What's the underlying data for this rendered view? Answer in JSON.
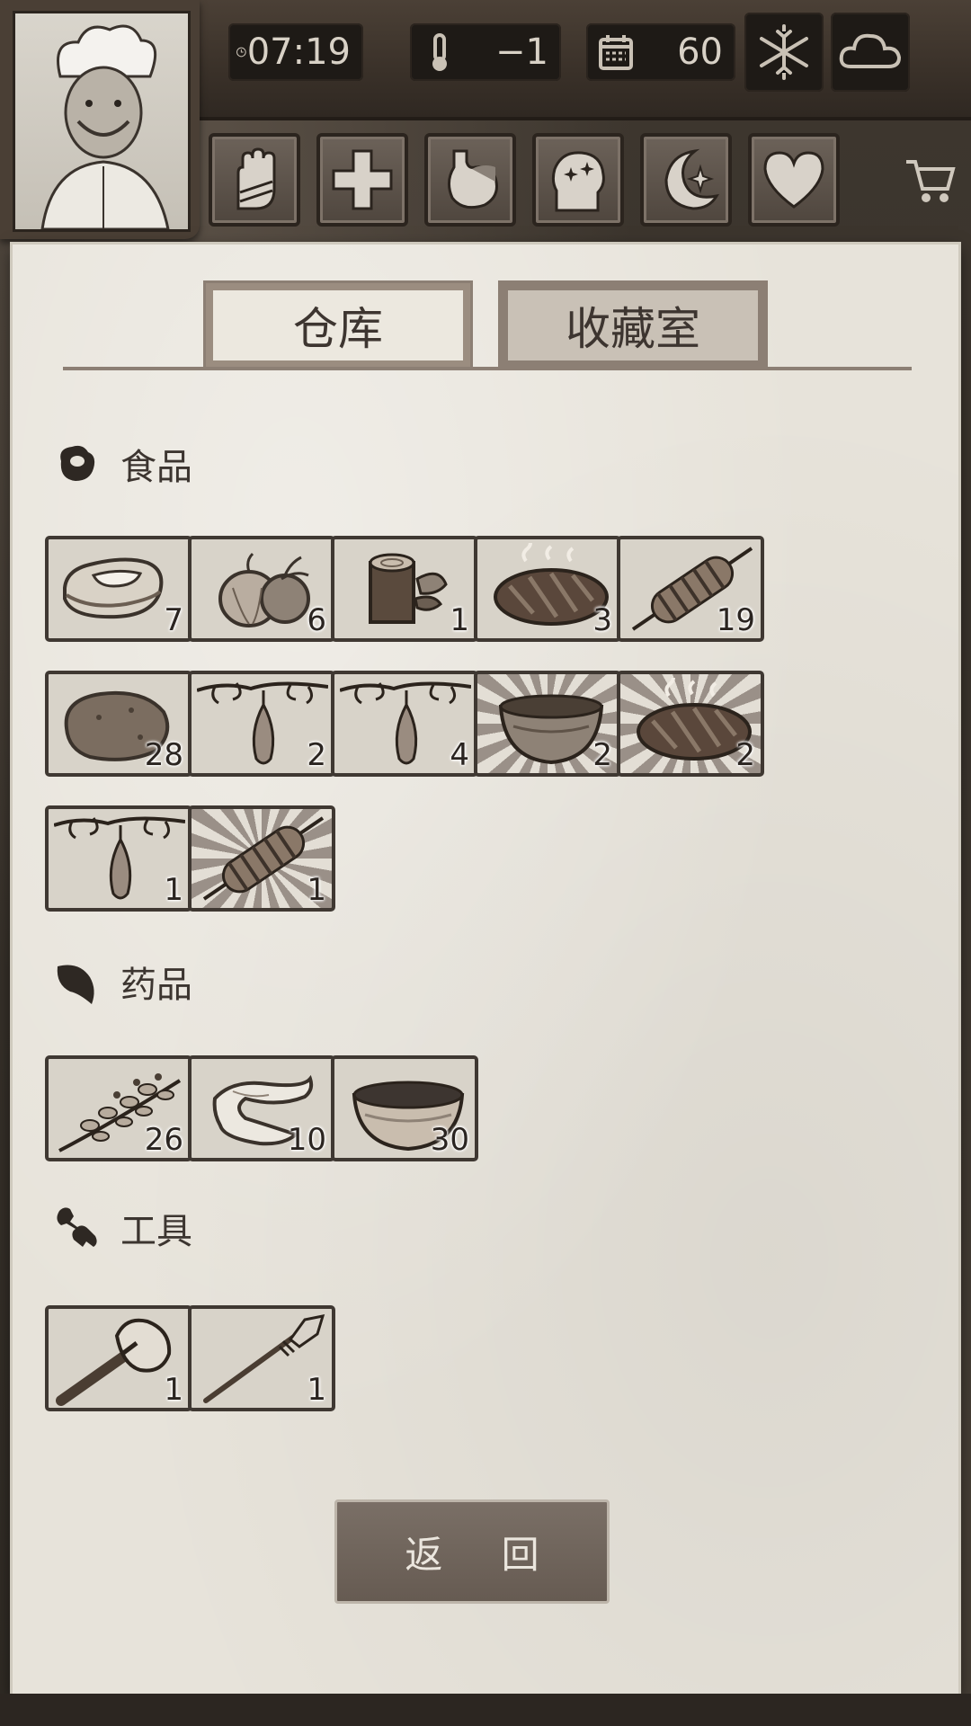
{
  "status_bar": {
    "time": "07:19",
    "temperature": "−1",
    "days": "60",
    "weather_icons": [
      "snowflake-icon",
      "cloud-icon"
    ]
  },
  "action_icons": [
    "hand-icon",
    "medical-cross-icon",
    "stomach-icon",
    "head-sanity-icon",
    "moon-sleep-icon",
    "heart-icon"
  ],
  "tabs": [
    {
      "label": "仓库",
      "active": true
    },
    {
      "label": "收藏室",
      "active": false
    }
  ],
  "sections": {
    "food": {
      "title": "食品",
      "items": [
        {
          "icon": "raw-meat-icon",
          "count": "7",
          "rare": false
        },
        {
          "icon": "onions-icon",
          "count": "6",
          "rare": false
        },
        {
          "icon": "wood-log-icon",
          "count": "1",
          "rare": false
        },
        {
          "icon": "grilled-steak-icon",
          "count": "3",
          "rare": false
        },
        {
          "icon": "skewer-icon",
          "count": "19",
          "rare": false
        },
        {
          "icon": "potato-icon",
          "count": "28",
          "rare": false
        },
        {
          "icon": "hanging-fruit-icon",
          "count": "2",
          "rare": false
        },
        {
          "icon": "hanging-fruit-icon",
          "count": "4",
          "rare": false
        },
        {
          "icon": "soup-bowl-icon",
          "count": "2",
          "rare": true
        },
        {
          "icon": "grilled-steak-icon",
          "count": "2",
          "rare": true
        },
        {
          "icon": "hanging-fruit-icon",
          "count": "1",
          "rare": false
        },
        {
          "icon": "skewer-icon",
          "count": "1",
          "rare": true
        }
      ]
    },
    "medicine": {
      "title": "药品",
      "items": [
        {
          "icon": "herb-branch-icon",
          "count": "26",
          "rare": false
        },
        {
          "icon": "bandage-icon",
          "count": "10",
          "rare": false
        },
        {
          "icon": "medicine-bowl-icon",
          "count": "30",
          "rare": false
        }
      ]
    },
    "tools": {
      "title": "工具",
      "items": [
        {
          "icon": "stone-axe-icon",
          "count": "1",
          "rare": false
        },
        {
          "icon": "spear-icon",
          "count": "1",
          "rare": false
        }
      ]
    }
  },
  "back_button": "返 回"
}
